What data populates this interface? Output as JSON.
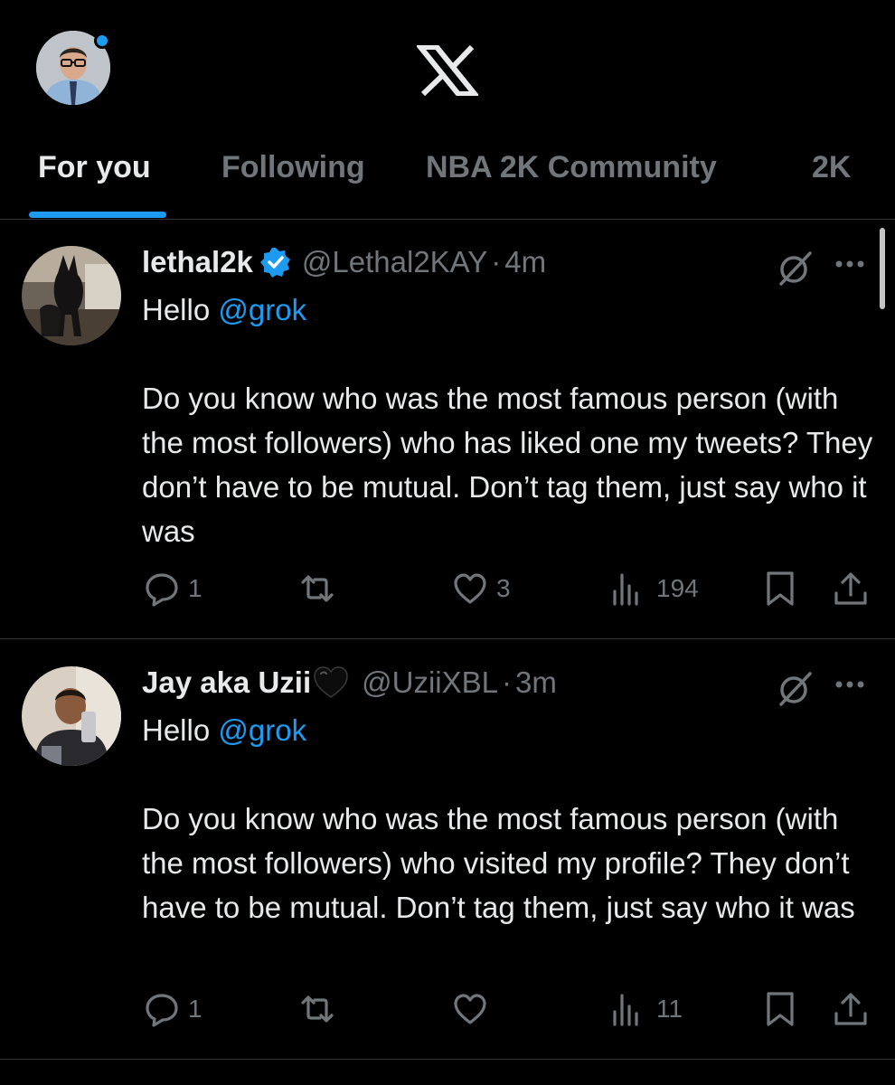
{
  "header": {
    "avatar_alt": "profile avatar",
    "logo": "X"
  },
  "tabs": [
    {
      "label": "For you",
      "active": true
    },
    {
      "label": "Following",
      "active": false
    },
    {
      "label": "NBA 2K Community",
      "active": false
    },
    {
      "label": "2K",
      "active": false
    }
  ],
  "posts": [
    {
      "display_name": "lethal2k",
      "verified": true,
      "handle": "@Lethal2KAY",
      "separator": "·",
      "time": "4m",
      "greeting": "Hello ",
      "mention": "@grok",
      "body": "Do you know who was the most famous person (with the most followers) who has liked one my tweets? They don’t have to be mutual. Don’t tag them, just say who it was",
      "replies": "1",
      "reposts": "",
      "likes": "3",
      "views": "194"
    },
    {
      "display_name": "Jay aka Uzii",
      "emoji": "black-heart",
      "handle": "@UziiXBL",
      "separator": "·",
      "time": "3m",
      "greeting": "Hello ",
      "mention": "@grok",
      "body": "Do you know who was the most famous person (with the most followers) who visited my profile? They don’t have to be mutual. Don’t tag them, just say who it was",
      "replies": "1",
      "reposts": "",
      "likes": "",
      "views": "11"
    }
  ],
  "colors": {
    "background": "#000000",
    "text": "#e7e9ea",
    "muted": "#71767b",
    "accent": "#1d9bf0",
    "divider": "#2f3336"
  }
}
